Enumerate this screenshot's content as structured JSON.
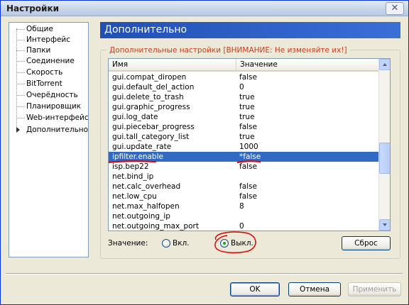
{
  "window": {
    "title": "Настройки",
    "close_glyph": "✕"
  },
  "nav": {
    "items": [
      {
        "label": "Общие"
      },
      {
        "label": "Интерфейс"
      },
      {
        "label": "Папки"
      },
      {
        "label": "Соединение"
      },
      {
        "label": "Скорость"
      },
      {
        "label": "BitTorrent"
      },
      {
        "label": "Очерёдность"
      },
      {
        "label": "Планировщик"
      },
      {
        "label": "Web-интерфейс"
      },
      {
        "label": "Дополнительно"
      }
    ],
    "selected_index": 9
  },
  "panel": {
    "header": "Дополнительно",
    "group_title": "Дополнительные настройки [ВНИМАНИЕ: Не изменяйте их!]",
    "columns": {
      "name": "Имя",
      "value": "Значение"
    },
    "rows": [
      {
        "name": "gui.compat_diropen",
        "value": "false"
      },
      {
        "name": "gui.default_del_action",
        "value": "0"
      },
      {
        "name": "gui.delete_to_trash",
        "value": "true"
      },
      {
        "name": "gui.graphic_progress",
        "value": "true"
      },
      {
        "name": "gui.log_date",
        "value": "true"
      },
      {
        "name": "gui.piecebar_progress",
        "value": "false"
      },
      {
        "name": "gui.tall_category_list",
        "value": "true"
      },
      {
        "name": "gui.update_rate",
        "value": "1000"
      },
      {
        "name": "ipfilter.enable",
        "value": "*false",
        "selected": true
      },
      {
        "name": "isp.bep22",
        "value": "false"
      },
      {
        "name": "net.bind_ip",
        "value": ""
      },
      {
        "name": "net.calc_overhead",
        "value": "false"
      },
      {
        "name": "net.low_cpu",
        "value": "false"
      },
      {
        "name": "net.max_halfopen",
        "value": "8"
      },
      {
        "name": "net.outgoing_ip",
        "value": ""
      },
      {
        "name": "net.outgoing_max_port",
        "value": "0"
      }
    ],
    "value_label": "Значение:",
    "radio_on": "Вкл.",
    "radio_off": "Выкл.",
    "radio_selected": "off",
    "reset_button": "Сброс"
  },
  "footer": {
    "ok": "OK",
    "cancel": "Отмена",
    "apply": "Применить"
  },
  "colors": {
    "selection": "#316ac5",
    "header_bar": "#2150b5",
    "warning_text": "#cc3b1a",
    "annotation": "#e00000"
  }
}
